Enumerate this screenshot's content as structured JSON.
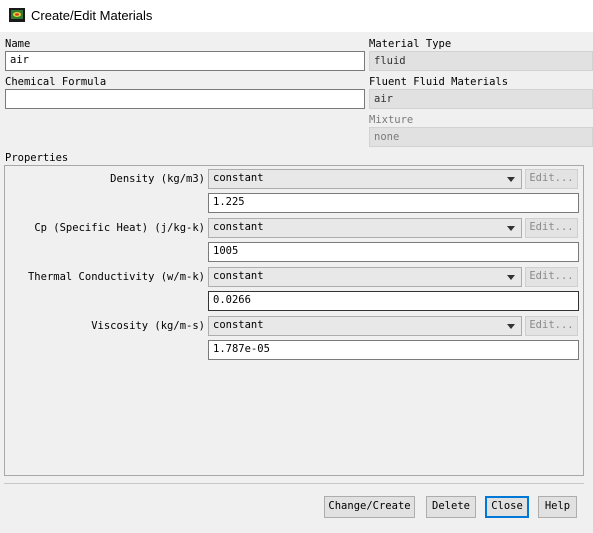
{
  "window": {
    "title": "Create/Edit Materials",
    "icon": "fluent-app-icon"
  },
  "form": {
    "name_label": "Name",
    "name_value": "air",
    "chemical_formula_label": "Chemical Formula",
    "chemical_formula_value": "",
    "material_type_label": "Material Type",
    "material_type_value": "fluid",
    "fluent_fluid_materials_label": "Fluent Fluid Materials",
    "fluent_fluid_materials_value": "air",
    "mixture_label": "Mixture",
    "mixture_value": "none"
  },
  "properties": {
    "group_label": "Properties",
    "items": [
      {
        "label": "Density (kg/m3)",
        "method": "constant",
        "edit_label": "Edit...",
        "value": "1.225"
      },
      {
        "label": "Cp (Specific Heat) (j/kg-k)",
        "method": "constant",
        "edit_label": "Edit...",
        "value": "1005"
      },
      {
        "label": "Thermal Conductivity (w/m-k)",
        "method": "constant",
        "edit_label": "Edit...",
        "value": "0.0266"
      },
      {
        "label": "Viscosity (kg/m-s)",
        "method": "constant",
        "edit_label": "Edit...",
        "value": "1.787e-05"
      }
    ]
  },
  "buttons": {
    "change_create": "Change/Create",
    "delete": "Delete",
    "close": "Close",
    "help": "Help"
  },
  "colors": {
    "default_button_border": "#0078d7",
    "readonly_bg": "#e1e1e1"
  }
}
